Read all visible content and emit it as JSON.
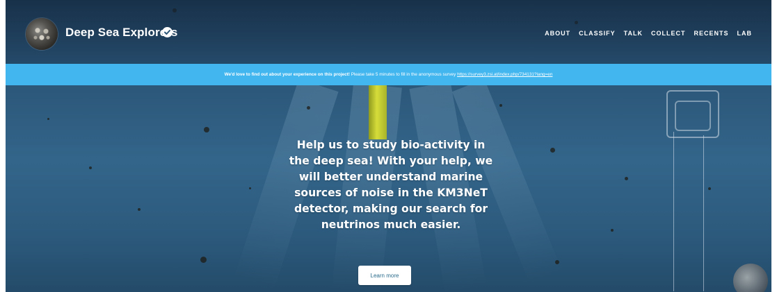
{
  "header": {
    "project_name": "Deep Sea Explorers",
    "avatar_icon": "project-avatar-icon",
    "verified_icon": "verified-badge-icon",
    "nav": [
      {
        "label": "ABOUT"
      },
      {
        "label": "CLASSIFY"
      },
      {
        "label": "TALK"
      },
      {
        "label": "COLLECT"
      },
      {
        "label": "RECENTS"
      },
      {
        "label": "LAB"
      }
    ]
  },
  "banner": {
    "bold_text": "We'd love to find out about your experience on this project!",
    "text": " Please take 5 minutes to fill in the anonymous survey ",
    "link_text": "https://survey3.zsi.at/index.php/734131?lang=en",
    "color": "#42b6ef"
  },
  "hero": {
    "description": "Help us to study bio-activity in the deep sea! With your help, we will better understand marine sources of noise in the KM3NeT detector, making our search for neutrinos much easier.",
    "button_label": "Learn more"
  },
  "colors": {
    "accent": "#42b6ef",
    "background": "#33658a"
  }
}
